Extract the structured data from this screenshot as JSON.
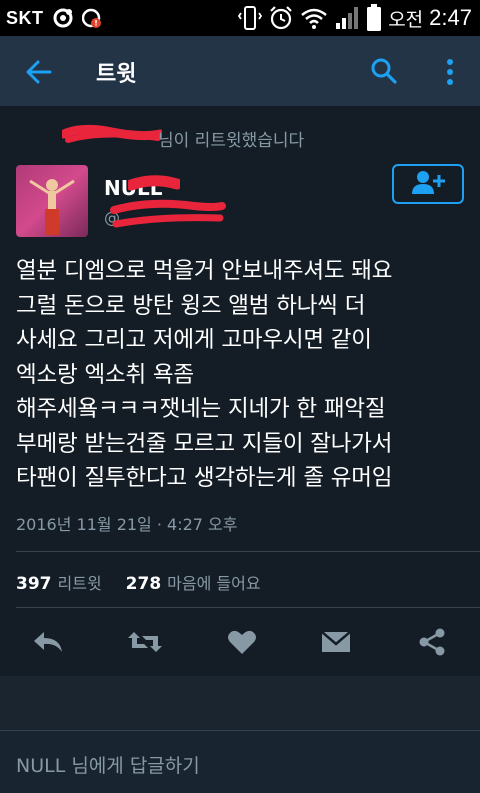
{
  "status_bar": {
    "carrier": "SKT",
    "ampm": "오전",
    "time": "2:47",
    "icons": [
      "tmap-icon",
      "notification-badge-icon",
      "vibrate-icon",
      "alarm-icon",
      "wifi-icon",
      "signal-icon",
      "battery-icon"
    ]
  },
  "app_bar": {
    "title": "트윗",
    "back_icon": "arrow-left-icon",
    "search_icon": "search-icon",
    "more_icon": "more-vertical-icon",
    "bg_color": "#243447",
    "accent_color": "#1da1f2"
  },
  "tweet": {
    "retweet_notice": "님이 리트윗했습니다",
    "display_name": "NULL",
    "handle": "@",
    "text": "열분 디엠으로 먹을거 안보내주셔도 돼요\n그럴 돈으로 방탄 윙즈 앨범 하나씩 더\n사세요 그리고 저에게 고마우시면 같이\n엑소랑 엑소취 욕좀\n해주세욬ㅋㅋㅋ잿네는 지네가 한 패악질\n부메랑 받는건줄 모르고 지들이 잘나가서\n타팬이 질투한다고 생각하는게 졸 유머임",
    "timestamp": "2016년 11월 21일 · 4:27 오후",
    "retweet_count": "397",
    "retweet_label": "리트윗",
    "like_count": "278",
    "like_label": "마음에 들어요"
  },
  "actions": [
    "reply-icon",
    "retweet-icon",
    "heart-icon",
    "direct-message-icon",
    "share-icon"
  ],
  "reply": {
    "prefix": "NULL",
    "suffix": " 님에게 답글하기"
  }
}
